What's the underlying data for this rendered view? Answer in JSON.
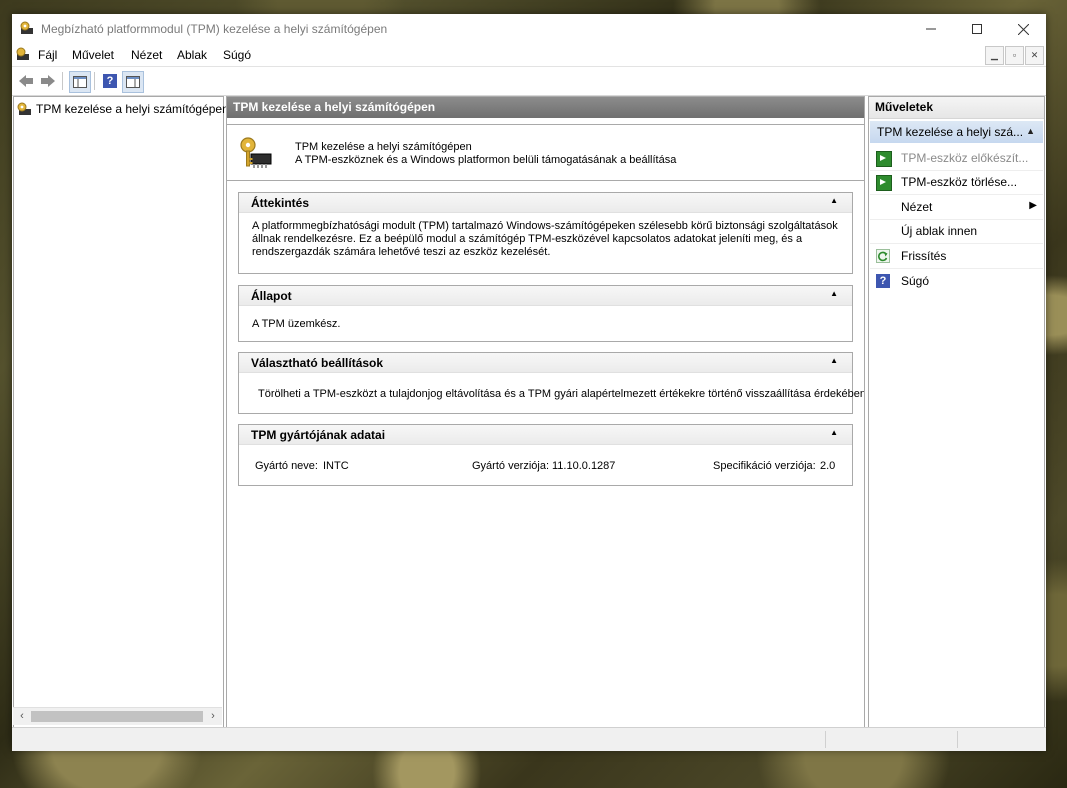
{
  "window": {
    "title": "Megbízható platformmodul (TPM) kezelése a helyi számítógépen"
  },
  "menu": {
    "items": [
      "Fájl",
      "Művelet",
      "Nézet",
      "Ablak",
      "Súgó"
    ]
  },
  "tree": {
    "root_label": "TPM kezelése a helyi számítógépen"
  },
  "center": {
    "header": "TPM kezelése a helyi számítógépen",
    "intro_title": "TPM kezelése a helyi számítógépen",
    "intro_desc": "A TPM-eszköznek és a Windows platformon belüli támogatásának a beállítása",
    "sections": {
      "overview": {
        "title": "Áttekintés",
        "lines": [
          "A platformmegbízhatósági modult (TPM) tartalmazó Windows-számítógépeken szélesebb körű biztonsági szolgáltatások",
          "állnak rendelkezésre. Ez a beépülő modul a számítógép TPM-eszközével kapcsolatos adatokat jeleníti meg, és a",
          "rendszergazdák számára lehetővé teszi az eszköz kezelését."
        ]
      },
      "status": {
        "title": "Állapot",
        "text": "A TPM üzemkész."
      },
      "options": {
        "title": "Választható beállítások",
        "text": "Törölheti a TPM-eszközt a tulajdonjog eltávolítása és a TPM gyári alapértelmezett értékekre történő visszaállítása érdekében."
      },
      "manufacturer": {
        "title": "TPM gyártójának adatai",
        "name_label": "Gyártó neve:",
        "name_value": "INTC",
        "version_label": "Gyártó verziója:",
        "version_value": "11.10.0.1287",
        "spec_label": "Specifikáció verziója:",
        "spec_value": "2.0"
      }
    }
  },
  "actions": {
    "header": "Műveletek",
    "subheader": "TPM kezelése a helyi szá...",
    "items": [
      {
        "label": "TPM-eszköz előkészít...",
        "icon": "green-arrow-icon",
        "disabled": true
      },
      {
        "label": "TPM-eszköz törlése...",
        "icon": "green-arrow-icon",
        "disabled": false
      },
      {
        "label": "Nézet",
        "icon": "",
        "submenu": true
      },
      {
        "label": "Új ablak innen",
        "icon": ""
      },
      {
        "label": "Frissítés",
        "icon": "refresh-icon"
      },
      {
        "label": "Súgó",
        "icon": "help-icon"
      }
    ]
  },
  "colors": {
    "header_dark": "#7a7a7a",
    "selection": "#cddcf0",
    "disabled_text": "#8a8a8a",
    "green": "#2e8b2e",
    "help_blue": "#3d56b0"
  }
}
